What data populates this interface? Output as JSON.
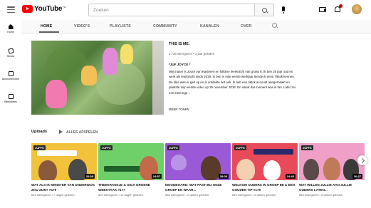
{
  "header": {
    "logo_text": "YouTube",
    "logo_country": "NL",
    "search_placeholder": "Zoeken"
  },
  "leftnav": {
    "items": [
      {
        "label": "Home",
        "icon": "home-icon"
      },
      {
        "label": "Shorts",
        "icon": "shorts-icon"
      },
      {
        "label": "Abonnementen",
        "icon": "subscriptions-icon"
      },
      {
        "label": "Bibliotheek",
        "icon": "library-icon"
      }
    ]
  },
  "tabs": {
    "items": [
      "HOME",
      "VIDEO'S",
      "PLAYLISTS",
      "COMMUNITY",
      "KANALEN",
      "OVER"
    ],
    "active": "HOME"
  },
  "featured": {
    "title": "THIS IS ME.",
    "meta": "2.726 weergaven • 1 jaar geleden",
    "subtitle": "*JUF JOYCE *",
    "description": "Mijn naam is Joyce van Kasteren en fulltime leerkracht van groep 6. Ik ben 26 jaar oud en werk als leerkracht sinds 2019. Ik ben in mijn eerste werkjaar leerde ik eerst Tiktok kennen. De klas was er gek op en ik ontdekte het ook. Ik heb een tiktok account aangemaakt en plaatste mijn eerste video op 29 november 2018. En vanaf dat moment was ik fan. Later zei een kind tege...",
    "more_label": "MEER TONEN"
  },
  "uploads": {
    "title": "Uploads",
    "play_all": "ALLES AFSPELEN",
    "videos": [
      {
        "title": "WAT ALS IK MINISTER VAN ONDERWIJS ZOU ZIJN? #179",
        "meta": "618 weergaven • 7 dagen geleden",
        "duration": "32:09",
        "bg": "#f2c23a"
      },
      {
        "title": "THEEKRANSJE & GIGA GROENE WEEKTAAK #177",
        "meta": "820 weergaven • 12 dagen geleden",
        "duration": "24:57",
        "bg": "#6fd06a"
      },
      {
        "title": "MOODBOARD: WAT PAST BIJ ONZE GROEP EN WAAR...",
        "meta": "588 weergaven • 2 weken geleden",
        "duration": "28:05",
        "bg": "#9a59d6"
      },
      {
        "title": "WELKOM OUDERS IN GROEP 8B & EEN GOUDEN TIP #175",
        "meta": "810 weergaven • 3 weken geleden",
        "duration": "24:45",
        "bg": "#e94a5a"
      },
      {
        "title": "WAT WILLEN JULLIE AAN JULLIE OUDERS LATEN...",
        "meta": "683 weergaven • 3 weken geleden",
        "duration": "30:27",
        "bg": "#f0a0c8"
      }
    ]
  }
}
